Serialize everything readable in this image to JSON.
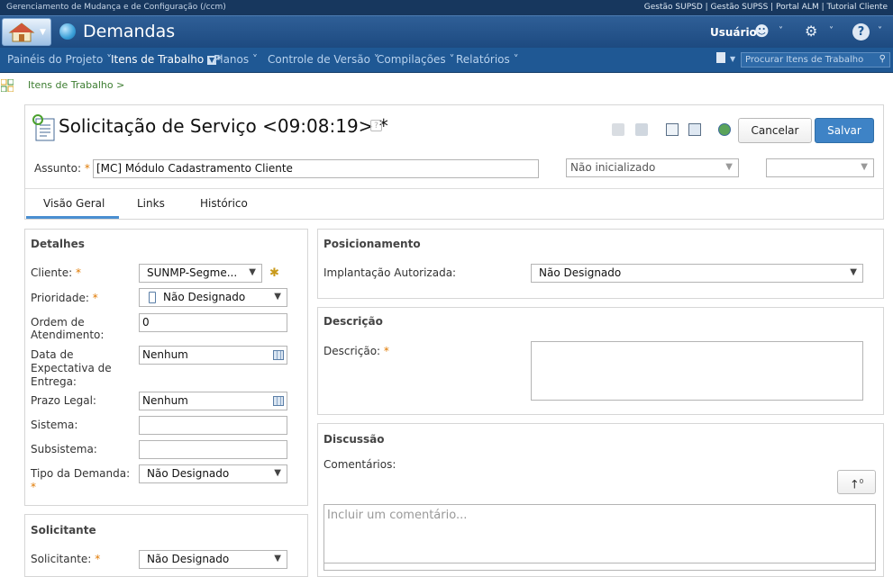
{
  "topbar": {
    "left": "Gerenciamento de Mudança e de Configuração (/ccm)",
    "right": "Gestão SUPSD | Gestão SUPSS | Portal ALM | Tutorial Cliente"
  },
  "banner": {
    "title": "Demandas",
    "user": "Usuário"
  },
  "nav": {
    "items": [
      "Painéis do Projeto",
      "Itens de Trabalho",
      "Planos",
      "Controle de Versão",
      "Compilações",
      "Relatórios"
    ],
    "search_placeholder": "Procurar Itens de Trabalho"
  },
  "breadcrumb": "Itens de Trabalho >",
  "header": {
    "title": "Solicitação de Serviço <09:08:19> *",
    "help": "?",
    "cancel": "Cancelar",
    "save": "Salvar",
    "subject_label": "Assunto:",
    "subject_value": "[MC]  Módulo Cadastramento Cliente",
    "status": "Não inicializado",
    "status2": ""
  },
  "tabs": [
    "Visão Geral",
    "Links",
    "Histórico"
  ],
  "details": {
    "title": "Detalhes",
    "cliente_label": "Cliente:",
    "cliente_value": "SUNMP-Segme...",
    "prioridade_label": "Prioridade:",
    "prioridade_value": "Não Designado",
    "ordem_label1": "Ordem de",
    "ordem_label2": "Atendimento:",
    "ordem_value": "0",
    "data_label1": "Data de",
    "data_label2": "Expectativa de",
    "data_label3": "Entrega:",
    "data_value": "Nenhum",
    "prazo_label": "Prazo Legal:",
    "prazo_value": "Nenhum",
    "sistema_label": "Sistema:",
    "subsistema_label": "Subsistema:",
    "tipo_label": "Tipo da Demanda:",
    "tipo_value": "Não Designado"
  },
  "solicitante": {
    "title": "Solicitante",
    "label": "Solicitante:",
    "value": "Não Designado"
  },
  "posicionamento": {
    "title": "Posicionamento",
    "label": "Implantação Autorizada:",
    "value": "Não Designado"
  },
  "descricao": {
    "title": "Descrição",
    "label": "Descrição:"
  },
  "discussao": {
    "title": "Discussão",
    "label": "Comentários:",
    "placeholder": "Incluir um comentário...",
    "sort": "↑"
  },
  "colors": {
    "accent": "#3e83c6",
    "topbar": "#17375e",
    "navbar": "#1f5894",
    "required": "#e07900"
  }
}
